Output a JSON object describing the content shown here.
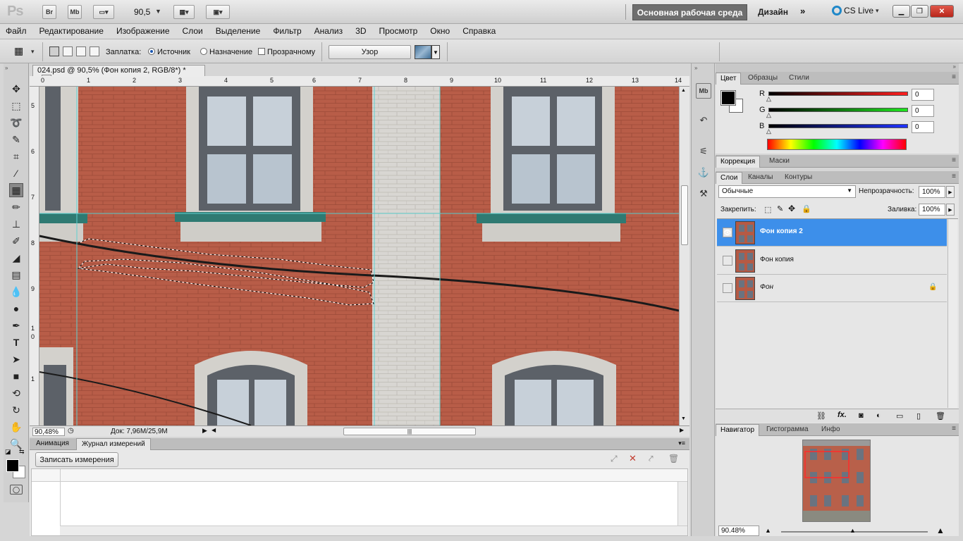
{
  "app": {
    "logo": "Ps",
    "zoom": "90,5",
    "workspace": "Основная рабочая среда",
    "design": "Дизайн",
    "cslive": "CS Live",
    "bridge": "Br",
    "minibridge": "Mb"
  },
  "menu": [
    "Файл",
    "Редактирование",
    "Изображение",
    "Слои",
    "Выделение",
    "Фильтр",
    "Анализ",
    "3D",
    "Просмотр",
    "Окно",
    "Справка"
  ],
  "options": {
    "patch_label": "Заплатка:",
    "source": "Источник",
    "destination": "Назначение",
    "transparent": "Прозрачному",
    "pattern_btn": "Узор"
  },
  "document": {
    "tab": "024.psd @ 90,5% (Фон копия 2, RGB/8*) *",
    "zoom": "90,48%",
    "doc_info": "Док: 7,96M/25,9M",
    "ruler_top": [
      "0",
      "1",
      "2",
      "3",
      "4",
      "5",
      "6",
      "7",
      "8",
      "9",
      "10",
      "11",
      "12",
      "13",
      "14"
    ],
    "ruler_left": [
      "5",
      "6",
      "7",
      "8",
      "9",
      "1",
      "0",
      "1"
    ]
  },
  "bottom_panel": {
    "tabs": [
      "Анимация",
      "Журнал измерений"
    ],
    "record": "Записать измерения"
  },
  "color_panel": {
    "tabs": [
      "Цвет",
      "Образцы",
      "Стили"
    ],
    "channels": [
      {
        "label": "R",
        "value": "0",
        "color": "#d21e1e"
      },
      {
        "label": "G",
        "value": "0",
        "color": "#1fc91f"
      },
      {
        "label": "B",
        "value": "0",
        "color": "#1f2fd6"
      }
    ]
  },
  "adjust_panel": {
    "tabs": [
      "Коррекция",
      "Маски"
    ]
  },
  "layers_panel": {
    "tabs": [
      "Слои",
      "Каналы",
      "Контуры"
    ],
    "blend": "Обычные",
    "opacity_label": "Непрозрачность:",
    "opacity": "100%",
    "lock_label": "Закрепить:",
    "fill_label": "Заливка:",
    "fill": "100%",
    "layers": [
      {
        "name": "Фон копия 2",
        "selected": true
      },
      {
        "name": "Фон копия",
        "selected": false
      },
      {
        "name": "Фон",
        "selected": false
      }
    ],
    "footer": "fx."
  },
  "nav_panel": {
    "tabs": [
      "Навигатор",
      "Гистограмма",
      "Инфо"
    ],
    "zoom": "90.48%"
  }
}
